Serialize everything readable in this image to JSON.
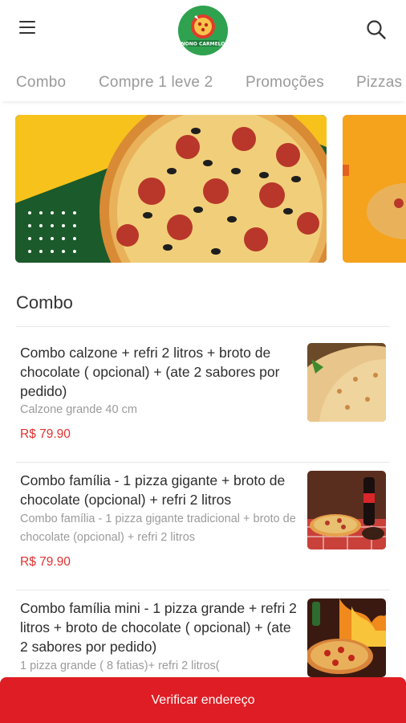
{
  "header": {
    "menu_icon": "hamburger-menu-icon",
    "search_icon": "search-icon",
    "logo_text": "Nono Carmelo"
  },
  "tabs": [
    {
      "label": "Combo"
    },
    {
      "label": "Compre 1 leve 2"
    },
    {
      "label": "Promoções"
    },
    {
      "label": "Pizzas"
    }
  ],
  "section": {
    "title": "Combo"
  },
  "items": [
    {
      "name": "Combo calzone + refri 2 litros + broto de chocolate ( opcional) + (ate 2 sabores por pedido)",
      "description": "Calzone grande 40 cm",
      "price": "R$ 79.90"
    },
    {
      "name": "Combo família - 1 pizza gigante + broto de chocolate (opcional) + refri 2 litros",
      "description": "Combo família - 1 pizza gigante tradicional + broto de chocolate (opcional) + refri 2 litros",
      "price": "R$ 79.90"
    },
    {
      "name": "Combo família mini - 1 pizza grande + refri 2 litros + broto de chocolate ( opcional) + (ate 2 sabores por pedido)",
      "description": "1 pizza grande ( 8 fatias)+ refri 2 litros(",
      "price": ""
    }
  ],
  "cta": {
    "label": "Verificar endereço"
  },
  "colors": {
    "accent": "#de1e24",
    "price": "#e0312e",
    "logo_green": "#2fa24f"
  }
}
